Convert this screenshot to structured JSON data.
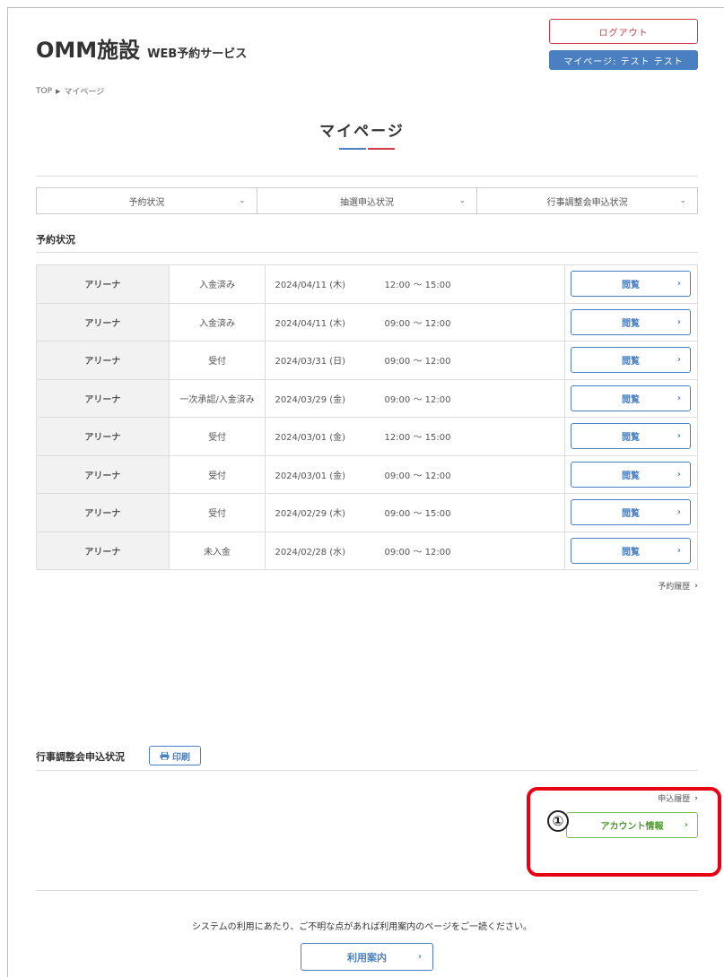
{
  "header": {
    "title_main": "OMM施設",
    "title_sub": "WEB予約サービス",
    "logout_label": "ログアウト",
    "mypage_label": "マイページ: テスト テスト"
  },
  "breadcrumb": {
    "top": "TOP",
    "separator": "▶",
    "current": "マイページ"
  },
  "page_title": "マイページ",
  "tabs": [
    {
      "label": "予約状況"
    },
    {
      "label": "抽選申込状況"
    },
    {
      "label": "行事調整会申込状況"
    }
  ],
  "reservation_section": {
    "label": "予約状況",
    "view_label": "閲覧",
    "rows": [
      {
        "facility": "アリーナ",
        "status": "入金済み",
        "date": "2024/04/11 (木)",
        "time": "12:00 ～ 15:00"
      },
      {
        "facility": "アリーナ",
        "status": "入金済み",
        "date": "2024/04/11 (木)",
        "time": "09:00 ～ 12:00"
      },
      {
        "facility": "アリーナ",
        "status": "受付",
        "date": "2024/03/31 (日)",
        "time": "09:00 ～ 12:00"
      },
      {
        "facility": "アリーナ",
        "status": "一次承認/入金済み",
        "date": "2024/03/29 (金)",
        "time": "09:00 ～ 12:00"
      },
      {
        "facility": "アリーナ",
        "status": "受付",
        "date": "2024/03/01 (金)",
        "time": "12:00 ～ 15:00"
      },
      {
        "facility": "アリーナ",
        "status": "受付",
        "date": "2024/03/01 (金)",
        "time": "09:00 ～ 12:00"
      },
      {
        "facility": "アリーナ",
        "status": "受付",
        "date": "2024/02/29 (木)",
        "time": "09:00 ～ 15:00"
      },
      {
        "facility": "アリーナ",
        "status": "未入金",
        "date": "2024/02/28 (水)",
        "time": "09:00 ～ 12:00"
      }
    ],
    "history_label": "予約履歴"
  },
  "event_section": {
    "label": "行事調整会申込状況",
    "print_label": "印刷",
    "history_label": "申込履歴"
  },
  "annotation": {
    "number": "①"
  },
  "account_button_label": "アカウント情報",
  "footer": {
    "notice": "システムの利用にあたり、ご不明な点があれば利用案内のページをご一読ください。",
    "guide_label": "利用案内"
  },
  "icons": {
    "chevron": "chevron-right-icon",
    "dropdown": "chevron-down-icon",
    "print": "printer-icon"
  },
  "colors": {
    "primary_blue": "#4a7fc1",
    "accent_red": "#d23a4a",
    "account_green": "#4c9a2e",
    "highlight_red": "#e60012"
  }
}
